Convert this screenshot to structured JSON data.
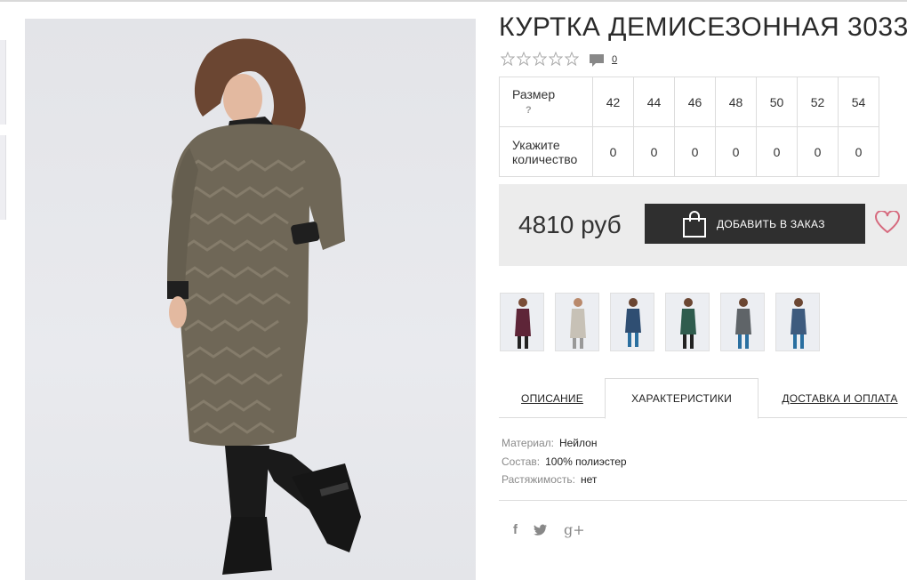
{
  "product": {
    "title": "КУРТКА ДЕМИСЕЗОННАЯ 3033",
    "comment_count": "0",
    "price": "4810 руб",
    "add_button_label": "ДОБАВИТЬ В ЗАКАЗ"
  },
  "rating": {
    "stars_filled": 0,
    "stars_total": 5
  },
  "size_table": {
    "size_label": "Размер",
    "help_mark": "?",
    "qty_label_line1": "Укажите",
    "qty_label_line2": "количество",
    "sizes": [
      "42",
      "44",
      "46",
      "48",
      "50",
      "52",
      "54"
    ],
    "quantities": [
      "0",
      "0",
      "0",
      "0",
      "0",
      "0",
      "0"
    ]
  },
  "color_variants": [
    {
      "name": "burgundy",
      "color": "#5e2538"
    },
    {
      "name": "beige",
      "color": "#c7c1b6"
    },
    {
      "name": "blue",
      "color": "#2f4e72"
    },
    {
      "name": "green",
      "color": "#2f5c4e"
    },
    {
      "name": "grey-pattern",
      "color": "#5f6468"
    },
    {
      "name": "blue-pattern",
      "color": "#3e5b7e"
    }
  ],
  "tabs": {
    "description": "ОПИСАНИЕ",
    "characteristics": "ХАРАКТЕРИСТИКИ",
    "delivery": "ДОСТАВКА И ОПЛАТА"
  },
  "specs": [
    {
      "key": "Материал:",
      "value": "Нейлон"
    },
    {
      "key": "Состав:",
      "value": "100% полиэстер"
    },
    {
      "key": "Растяжимость:",
      "value": "нет"
    }
  ],
  "social": {
    "facebook": "f",
    "twitter": "twitter-icon",
    "google": "g+"
  },
  "colors": {
    "button_bg": "#2f2f2f",
    "heart": "#d66a7e",
    "price_bg": "#ececec",
    "coat": "#6f6757"
  }
}
